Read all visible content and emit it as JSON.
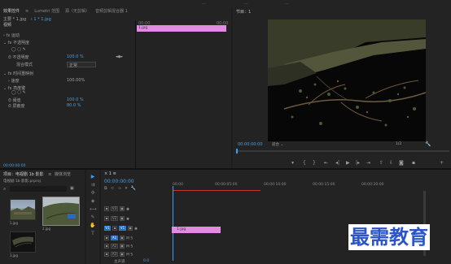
{
  "topbar": {
    "items": [
      "...",
      "...",
      "..."
    ]
  },
  "effects": {
    "tabs": [
      "效果控件",
      "Lumetri 范围",
      "源（无剪辑）",
      "音频剪辑混合器 1"
    ],
    "header_source": "主要 * 1.jpg",
    "header_clip": "1 * 1.jpg",
    "section": "视频",
    "time_ruler": "00:00",
    "time_ruler_end": "00:00",
    "clip_label": "1.jpg",
    "rows": [
      {
        "label": "运动",
        "value": ""
      },
      {
        "label": "不透明度",
        "value": ""
      },
      {
        "label": "不透明度",
        "value": "100.0 %"
      },
      {
        "label": "混合模式",
        "value": "正常"
      },
      {
        "label": "时间重映射",
        "value": ""
      },
      {
        "label": "速度",
        "value": "100.00%"
      },
      {
        "label": "亮度键",
        "value": ""
      },
      {
        "label": "阈值",
        "value": "100.0 %"
      },
      {
        "label": "屏蔽度",
        "value": "80.0 %"
      }
    ],
    "footer_time": "00:00:00:00"
  },
  "program": {
    "title": "节目：1",
    "timecode": "00:00:00:00",
    "fit": "适合",
    "fraction": "1/2"
  },
  "project": {
    "title": "项目：电视剧",
    "tabs": [
      "项目：电视剧 1b 影影",
      "媒体浏览"
    ],
    "file_label": "电视剧 1b 影影.prproj",
    "items": [
      {
        "label": "1.jpg",
        "dur": ""
      },
      {
        "label": "2.jpg",
        "dur": ""
      },
      {
        "label": "3.jpg",
        "dur": ""
      }
    ]
  },
  "timeline": {
    "title": "1",
    "timecode": "00:00:00:00",
    "ruler": [
      "00:00",
      "00:00:05:00",
      "00:00:10:00",
      "00:00:15:00",
      "00:00:20:00"
    ],
    "tracks": [
      "V3",
      "V2",
      "V1",
      "A1",
      "A2",
      "A3"
    ],
    "clip": "1.jpg",
    "master": "主声道",
    "master_value": "0.0"
  },
  "watermark": "最需教育",
  "colors": {
    "accent": "#3b9bff",
    "clip": "#e48ae4",
    "playhead": "#3b9bff",
    "bg": "#1d1d1d",
    "panel": "#232323",
    "watermark": "#2a55c8"
  }
}
